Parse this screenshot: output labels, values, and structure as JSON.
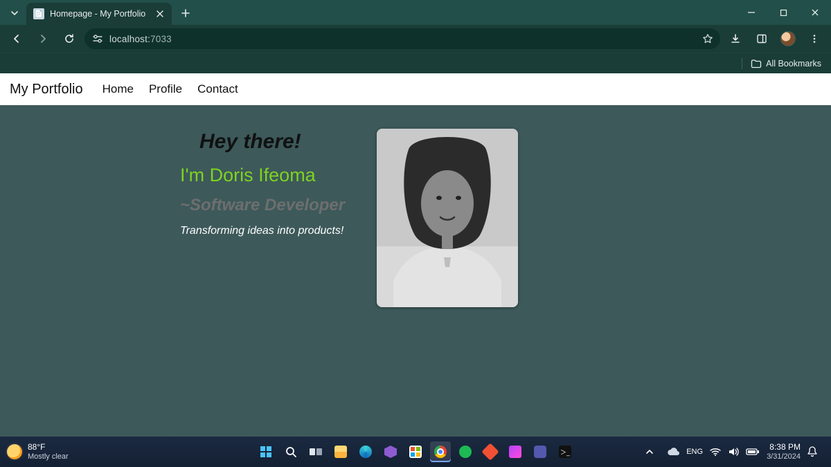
{
  "browser": {
    "tab_title": "Homepage - My Portfolio",
    "url_host": "localhost:",
    "url_port": "7033",
    "bookmarks_label": "All Bookmarks"
  },
  "nav": {
    "brand": "My Portfolio",
    "links": {
      "home": "Home",
      "profile": "Profile",
      "contact": "Contact"
    }
  },
  "hero": {
    "greeting": "Hey there!",
    "name": "I'm Doris Ifeoma",
    "role": "~Software Developer",
    "tagline": "Transforming ideas into products!"
  },
  "taskbar": {
    "temp": "88°F",
    "condition": "Mostly clear",
    "time": "8:38 PM",
    "date": "3/31/2024"
  }
}
